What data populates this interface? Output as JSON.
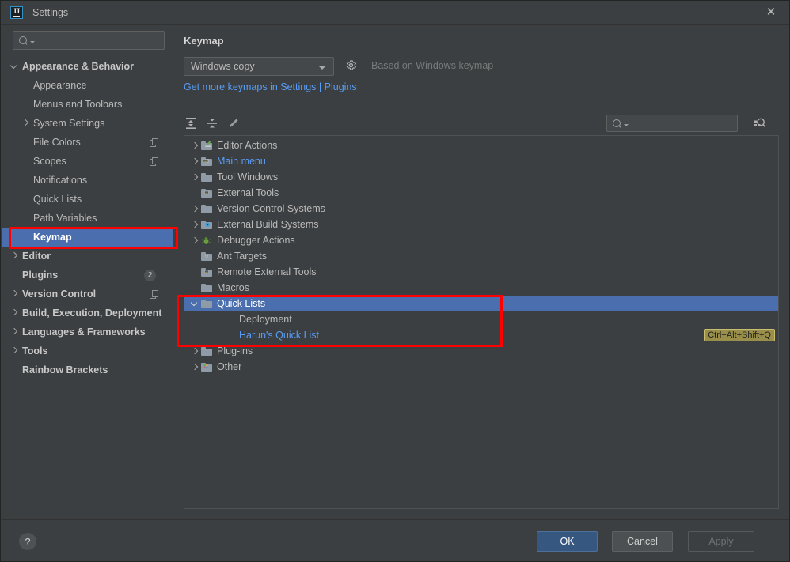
{
  "window": {
    "title": "Settings",
    "app_icon": "intellij-idea-icon",
    "close_icon": "close-icon"
  },
  "sidebar": {
    "search": {
      "placeholder": "",
      "value": "",
      "icon": "search-icon"
    },
    "items": [
      {
        "label": "Appearance & Behavior",
        "indent": 0,
        "arrow": "open",
        "bold": true,
        "selected": false
      },
      {
        "label": "Appearance",
        "indent": 1,
        "arrow": "none",
        "bold": false,
        "selected": false
      },
      {
        "label": "Menus and Toolbars",
        "indent": 1,
        "arrow": "none",
        "bold": false,
        "selected": false
      },
      {
        "label": "System Settings",
        "indent": 1,
        "arrow": "closed",
        "bold": false,
        "selected": false
      },
      {
        "label": "File Colors",
        "indent": 1,
        "arrow": "none",
        "bold": false,
        "selected": false,
        "copy_icon": true
      },
      {
        "label": "Scopes",
        "indent": 1,
        "arrow": "none",
        "bold": false,
        "selected": false,
        "copy_icon": true
      },
      {
        "label": "Notifications",
        "indent": 1,
        "arrow": "none",
        "bold": false,
        "selected": false
      },
      {
        "label": "Quick Lists",
        "indent": 1,
        "arrow": "none",
        "bold": false,
        "selected": false
      },
      {
        "label": "Path Variables",
        "indent": 1,
        "arrow": "none",
        "bold": false,
        "selected": false
      },
      {
        "label": "Keymap",
        "indent": 1,
        "arrow": "none",
        "bold": true,
        "selected": true
      },
      {
        "label": "Editor",
        "indent": 0,
        "arrow": "closed",
        "bold": true,
        "selected": false
      },
      {
        "label": "Plugins",
        "indent": 0,
        "arrow": "none",
        "bold": true,
        "selected": false,
        "badge": "2"
      },
      {
        "label": "Version Control",
        "indent": 0,
        "arrow": "closed",
        "bold": true,
        "selected": false,
        "copy_icon": true
      },
      {
        "label": "Build, Execution, Deployment",
        "indent": 0,
        "arrow": "closed",
        "bold": true,
        "selected": false
      },
      {
        "label": "Languages & Frameworks",
        "indent": 0,
        "arrow": "closed",
        "bold": true,
        "selected": false
      },
      {
        "label": "Tools",
        "indent": 0,
        "arrow": "closed",
        "bold": true,
        "selected": false
      },
      {
        "label": "Rainbow Brackets",
        "indent": 0,
        "arrow": "none",
        "bold": true,
        "selected": false
      }
    ]
  },
  "main": {
    "title": "Keymap",
    "keymap_select": {
      "value": "Windows copy",
      "icon": "chevron-down-icon"
    },
    "gear_icon": "gear-icon",
    "based_on_text": "Based on Windows keymap",
    "get_more_link": "Get more keymaps in Settings | Plugins",
    "toolbar": [
      {
        "name": "expand-all-icon",
        "tooltip": "Expand All"
      },
      {
        "name": "collapse-all-icon",
        "tooltip": "Collapse All"
      },
      {
        "name": "edit-pencil-icon",
        "tooltip": "Edit Shortcut"
      }
    ],
    "search": {
      "placeholder": "",
      "value": "",
      "icon": "search-icon"
    },
    "find_by_shortcut_icon": "find-by-shortcut-icon",
    "tree": [
      {
        "label": "Editor Actions",
        "indent": 0,
        "arrow": "closed",
        "icon": "folder-editor",
        "link": false,
        "selected": false
      },
      {
        "label": "Main menu",
        "indent": 0,
        "arrow": "closed",
        "icon": "folder-menu",
        "link": true,
        "selected": false
      },
      {
        "label": "Tool Windows",
        "indent": 0,
        "arrow": "closed",
        "icon": "folder-plain",
        "link": false,
        "selected": false
      },
      {
        "label": "External Tools",
        "indent": 0,
        "arrow": "none",
        "icon": "folder-tools",
        "link": false,
        "selected": false
      },
      {
        "label": "Version Control Systems",
        "indent": 0,
        "arrow": "closed",
        "icon": "folder-plain",
        "link": false,
        "selected": false
      },
      {
        "label": "External Build Systems",
        "indent": 0,
        "arrow": "closed",
        "icon": "folder-gear",
        "link": false,
        "selected": false
      },
      {
        "label": "Debugger Actions",
        "indent": 0,
        "arrow": "closed",
        "icon": "bug-icon",
        "link": false,
        "selected": false
      },
      {
        "label": "Ant Targets",
        "indent": 0,
        "arrow": "none",
        "icon": "folder-ant",
        "link": false,
        "selected": false
      },
      {
        "label": "Remote External Tools",
        "indent": 0,
        "arrow": "none",
        "icon": "folder-tools",
        "link": false,
        "selected": false
      },
      {
        "label": "Macros",
        "indent": 0,
        "arrow": "none",
        "icon": "folder-plain",
        "link": false,
        "selected": false
      },
      {
        "label": "Quick Lists",
        "indent": 0,
        "arrow": "open",
        "icon": "folder-plain",
        "link": false,
        "selected": true
      },
      {
        "label": "Deployment",
        "indent": 1,
        "arrow": "none",
        "icon": "none",
        "link": false,
        "selected": false
      },
      {
        "label": "Harun's Quick List",
        "indent": 1,
        "arrow": "none",
        "icon": "none",
        "link": true,
        "selected": false,
        "shortcut": "Ctrl+Alt+Shift+Q"
      },
      {
        "label": "Plug-ins",
        "indent": 0,
        "arrow": "closed",
        "icon": "folder-plain",
        "link": false,
        "selected": false
      },
      {
        "label": "Other",
        "indent": 0,
        "arrow": "closed",
        "icon": "folder-other",
        "link": false,
        "selected": false
      }
    ]
  },
  "footer": {
    "help_label": "?",
    "ok_label": "OK",
    "cancel_label": "Cancel",
    "apply_label": "Apply"
  },
  "colors": {
    "selection_blue": "#4b6eaf",
    "link_blue": "#589df6",
    "annotation_red": "#ff0000",
    "shortcut_badge_bg": "#9a8f4a",
    "ok_button_bg": "#365880",
    "panel_bg": "#3c3f41"
  }
}
